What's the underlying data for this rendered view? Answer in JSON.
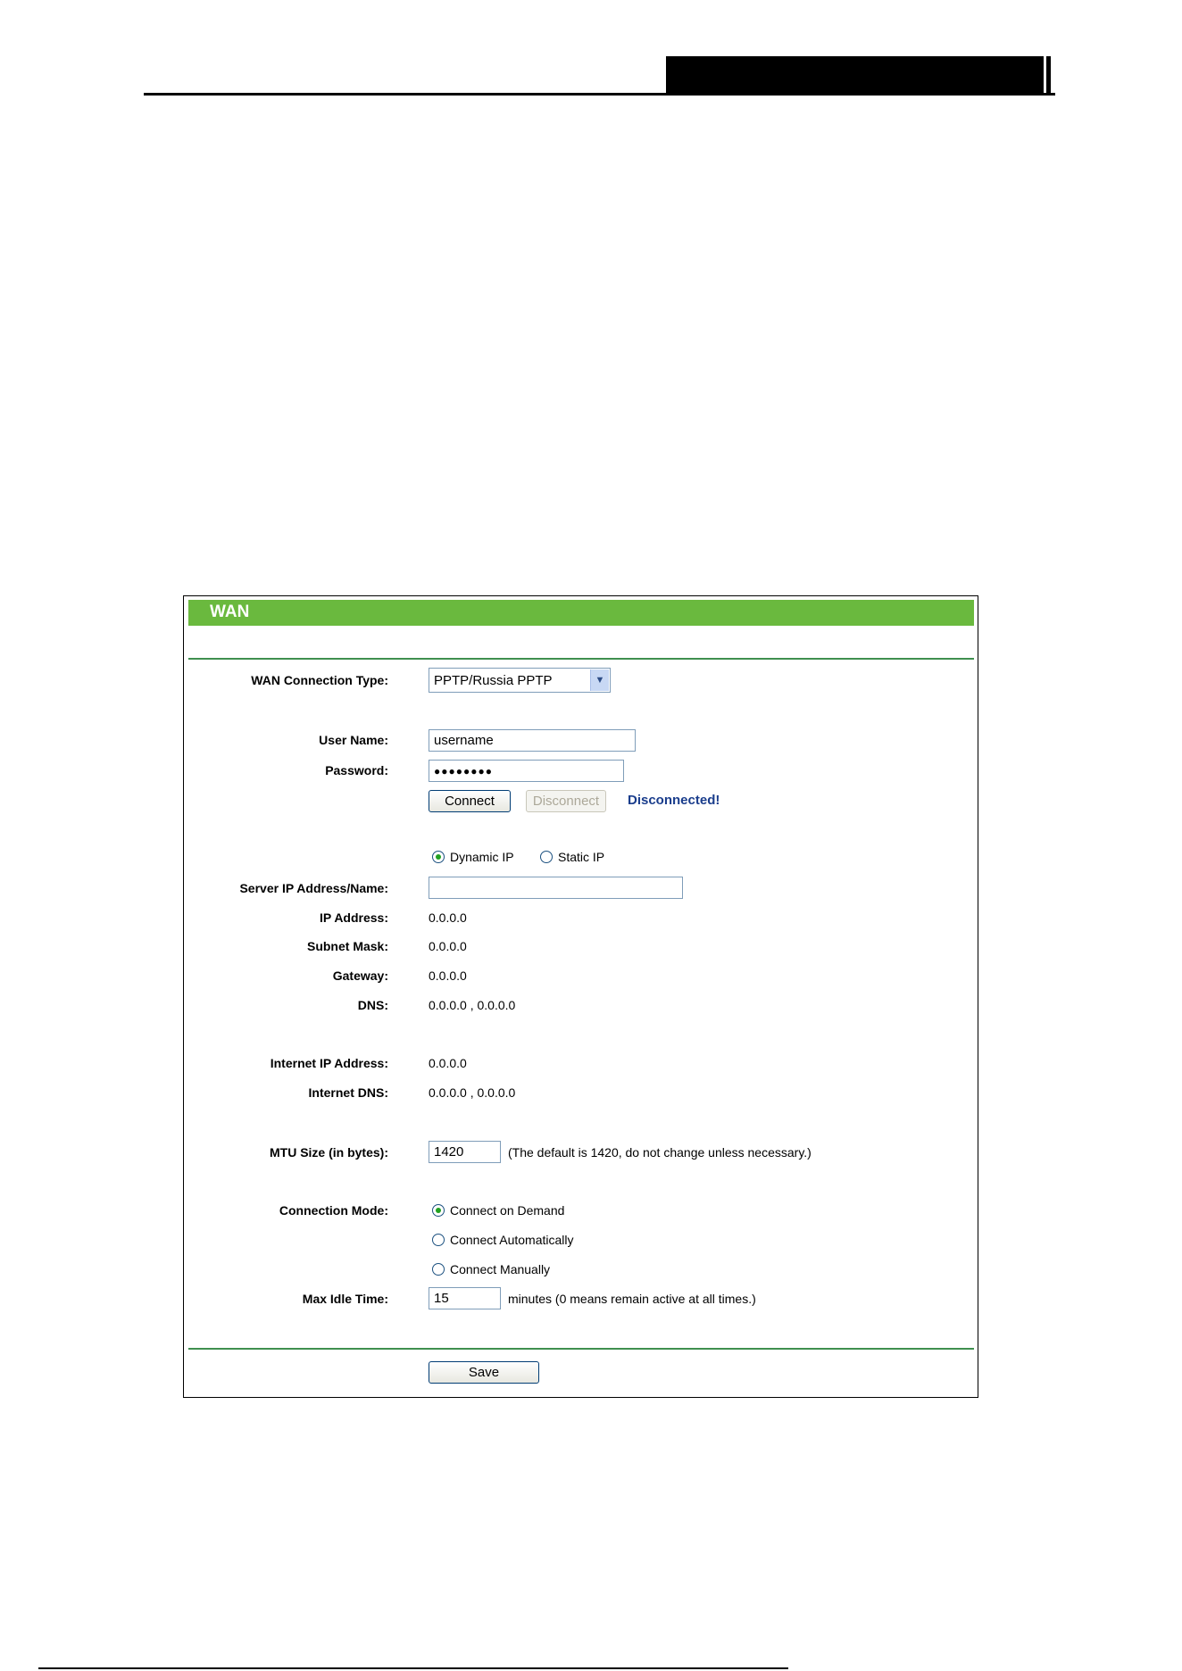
{
  "wan": {
    "title": "WAN",
    "connection_type_label": "WAN Connection Type:",
    "connection_type_value": "PPTP/Russia PPTP",
    "user_name_label": "User Name:",
    "user_name_value": "username",
    "password_label": "Password:",
    "password_value": "●●●●●●●●",
    "connect_label": "Connect",
    "disconnect_label": "Disconnect",
    "status_text": "Disconnected!",
    "dynamic_ip_label": "Dynamic IP",
    "static_ip_label": "Static IP",
    "ip_mode_selected": "Dynamic IP",
    "server_label": "Server IP Address/Name:",
    "server_value": "",
    "ip_address_label": "IP Address:",
    "ip_address_value": "0.0.0.0",
    "subnet_label": "Subnet Mask:",
    "subnet_value": "0.0.0.0",
    "gateway_label": "Gateway:",
    "gateway_value": "0.0.0.0",
    "dns_label": "DNS:",
    "dns_value": "0.0.0.0 , 0.0.0.0",
    "internet_ip_label": "Internet IP Address:",
    "internet_ip_value": "0.0.0.0",
    "internet_dns_label": "Internet DNS:",
    "internet_dns_value": "0.0.0.0 , 0.0.0.0",
    "mtu_label": "MTU Size (in bytes):",
    "mtu_value": "1420",
    "mtu_note": "(The default is 1420, do not change unless necessary.)",
    "connection_mode_label": "Connection Mode:",
    "mode_demand": "Connect on Demand",
    "mode_auto": "Connect Automatically",
    "mode_manual": "Connect Manually",
    "mode_selected": "Connect on Demand",
    "max_idle_label": "Max Idle Time:",
    "max_idle_value": "15",
    "max_idle_note": "minutes (0 means remain active at all times.)",
    "save_label": "Save"
  },
  "colors": {
    "header_green": "#6ab93e",
    "rule_green": "#3f8f4f",
    "status_blue": "#1a3d8c"
  }
}
